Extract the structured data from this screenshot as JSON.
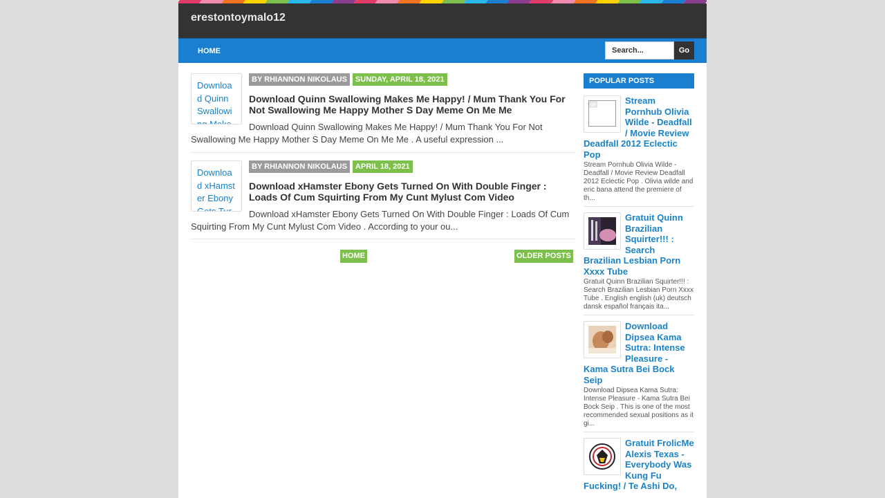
{
  "theme": {
    "accent": "#1a7fd0",
    "header_bg": "#333333",
    "date_green": "#7cc04b",
    "author_gray": "#9b9b9b",
    "link_blue": "#1a82c8"
  },
  "stripe_colors": [
    "#e23d6a",
    "#f08bb0",
    "#f37321",
    "#fbd400",
    "#7cc04b",
    "#27b7e8",
    "#1a7fd0",
    "#8b3d8f",
    "#e23d6a",
    "#f08bb0",
    "#f37321",
    "#fbd400",
    "#7cc04b",
    "#27b7e8",
    "#1a7fd0",
    "#8b3d8f",
    "#e23d6a",
    "#f08bb0",
    "#f37321",
    "#fbd400",
    "#7cc04b",
    "#27b7e8",
    "#1a7fd0",
    "#8b3d8f"
  ],
  "site": {
    "title": "erestontoymalo12"
  },
  "nav": {
    "home": "HOME"
  },
  "search": {
    "placeholder": "Search...",
    "button": "Go"
  },
  "posts": [
    {
      "thumb_alt": "Download Quinn Swallowing Makes",
      "author": "BY RHIANNON NIKOLAUS",
      "date": "SUNDAY, APRIL 18, 2021",
      "title": "Download Quinn Swallowing Makes Me Happy! / Mum Thank You For Not Swallowing Me Happy Mother S Day Meme On Me Me",
      "excerpt": "Download Quinn Swallowing Makes Me Happy! / Mum Thank You For Not Swallowing Me Happy Mother S Day Meme On Me Me . A useful expression ..."
    },
    {
      "thumb_alt": "Download xHamster Ebony Gets Turned",
      "author": "BY RHIANNON NIKOLAUS",
      "date": "APRIL 18, 2021",
      "title": "Download xHamster Ebony Gets Turned On With Double Finger : Loads Of Cum Squirting From My Cunt Mylust Com Video",
      "excerpt": "Download xHamster Ebony Gets Turned On With Double Finger : Loads Of Cum Squirting From My Cunt Mylust Com Video . According to your ou..."
    }
  ],
  "pager": {
    "home": "HOME",
    "older": "OLDER POSTS"
  },
  "sidebar": {
    "heading": "POPULAR POSTS",
    "items": [
      {
        "title": "Stream Pornhub Olivia Wilde - Deadfall / Movie Review Deadfall 2012 Eclectic Pop",
        "snippet": "Stream Pornhub Olivia Wilde - Deadfall / Movie Review Deadfall 2012 Eclectic Pop . Olivia wilde and eric bana attend the premiere of th...",
        "image": "broken-image-icon"
      },
      {
        "title": "Gratuit Quinn Brazilian Squirter!!! : Search Brazilian Lesbian Porn Xxxx Tube",
        "snippet": "Gratuit Quinn Brazilian Squirter!!! : Search Brazilian Lesbian Porn Xxxx Tube . English english (uk) deutsch dansk español français ita...",
        "image": "photo-thumbnail"
      },
      {
        "title": "Download Dipsea Kama Sutra: Intense Pleasure - Kama Sutra Bei Bock Seip",
        "snippet": "Download Dipsea Kama Sutra: Intense Pleasure - Kama Sutra Bei Bock Seip . This is one of the most recommended sexual positions as it gi...",
        "image": "photo-thumbnail"
      },
      {
        "title": "Gratuit FrolicMe Alexis Texas - Everybody Was Kung Fu Fucking! / Te Ashi Do,",
        "snippet": "",
        "image": "logo-thumbnail"
      }
    ]
  }
}
